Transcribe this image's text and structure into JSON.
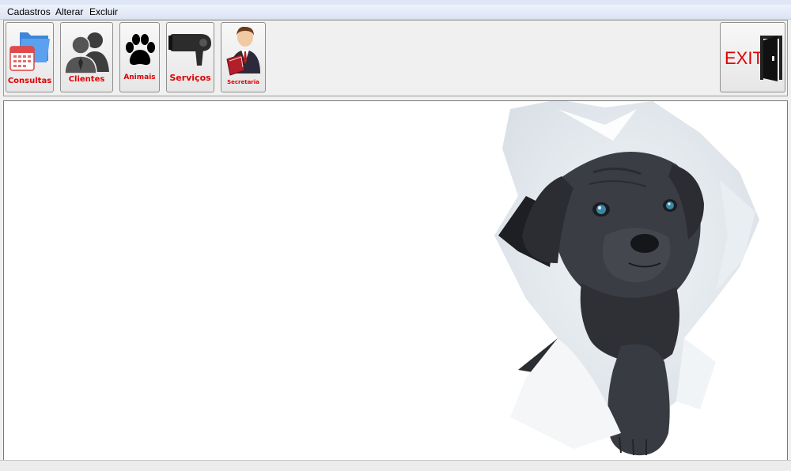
{
  "menu": {
    "items": [
      "Cadastros",
      "Alterar",
      "Excluir"
    ]
  },
  "toolbar": {
    "buttons": [
      {
        "label": "Consultas",
        "icon": "calendar-folder-icon"
      },
      {
        "label": "Clientes",
        "icon": "people-icon"
      },
      {
        "label": "Animais",
        "icon": "paw-icon"
      },
      {
        "label": "Serviços",
        "icon": "hair-dryer-icon"
      },
      {
        "label": "Secretaria",
        "icon": "secretary-icon"
      }
    ],
    "exit": {
      "label": "EXIT",
      "icon": "exit-door-icon"
    }
  },
  "colors": {
    "label_red": "#e00000",
    "menubar": "#dbe3f3",
    "background": "#f0f0f0"
  }
}
